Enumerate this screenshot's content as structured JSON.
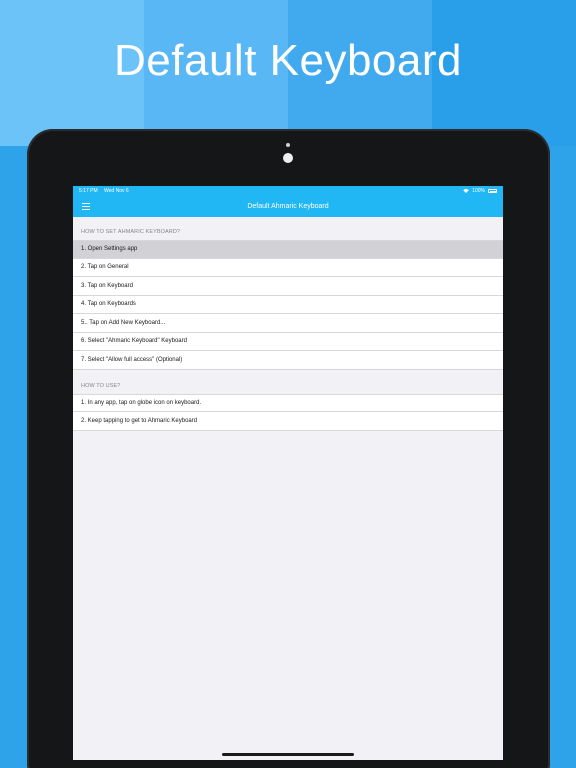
{
  "headline": "Default Keyboard",
  "statusbar": {
    "time": "5:17 PM",
    "date": "Wed Nov 6",
    "battery": "100%"
  },
  "navbar": {
    "title": "Default Ahmaric Keyboard",
    "menu_icon": "hamburger-menu-icon"
  },
  "sections": [
    {
      "header": "HOW TO SET AHMARIC KEYBOARD?",
      "rows": [
        "1. Open Settings app",
        "2. Tap on General",
        "3. Tap on Keyboard",
        "4. Tap on Keyboards",
        "5.. Tap on Add New Keyboard...",
        "6. Select \"Ahmaric Keyboard\" Keyboard",
        "7. Select \"Allow full access\" (Optional)"
      ]
    },
    {
      "header": "HOW TO USE?",
      "rows": [
        "1. In any app, tap on globe icon on keyboard.",
        "2. Keep tapping to get to Ahmaric Keyboard"
      ]
    }
  ],
  "colors": {
    "navbar": "#21b6f4",
    "screen_background": "#f1f1f6",
    "selected_row": "#d1d1d6"
  }
}
